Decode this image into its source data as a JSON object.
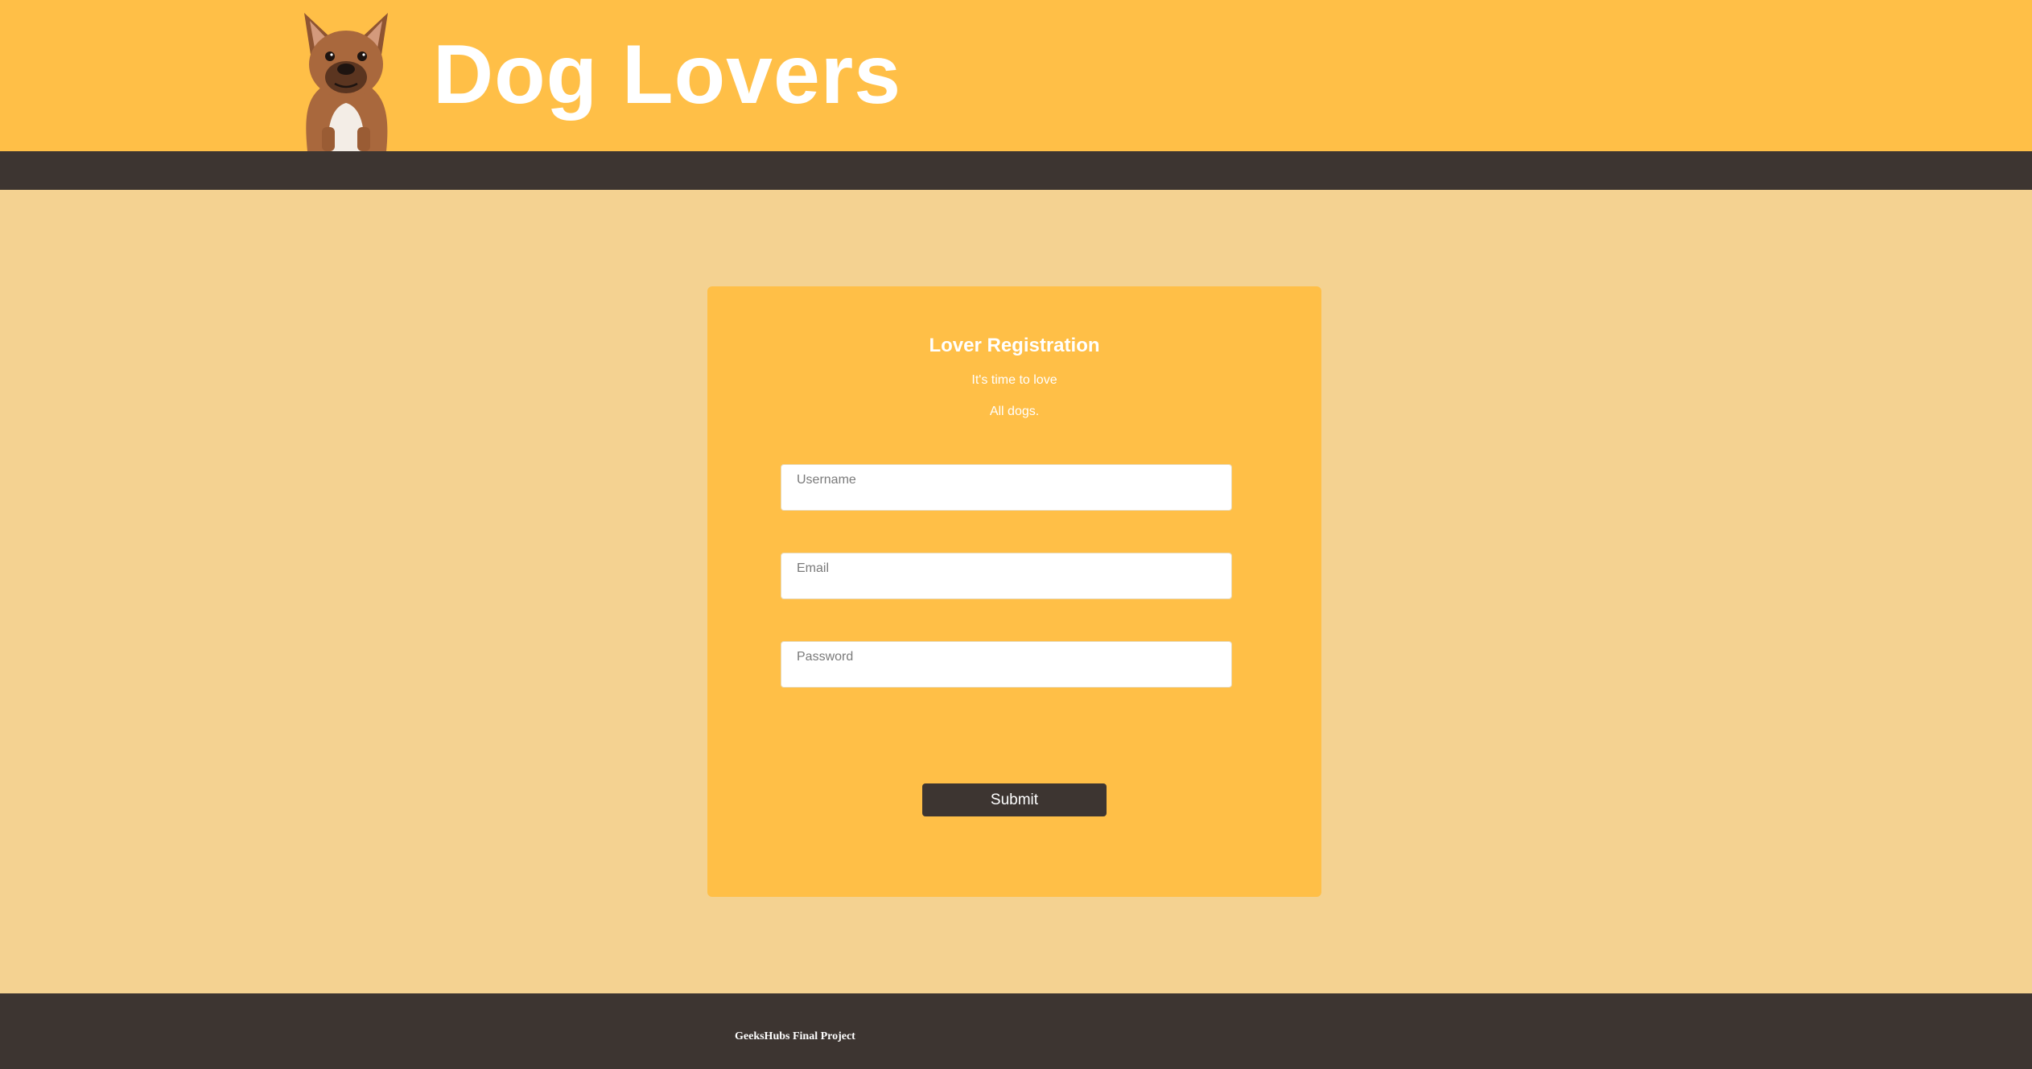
{
  "header": {
    "logo_icon": "french-bulldog-icon",
    "title": "Dog Lovers"
  },
  "form": {
    "title": "Lover Registration",
    "subtitle_line1": "It's time to love",
    "subtitle_line2": "All dogs.",
    "username": {
      "placeholder": "Username",
      "value": ""
    },
    "email": {
      "placeholder": "Email",
      "value": ""
    },
    "password": {
      "placeholder": "Password",
      "value": ""
    },
    "submit_label": "Submit"
  },
  "footer": {
    "text": "GeeksHubs Final Project"
  },
  "colors": {
    "header_bg": "#ffbf47",
    "nav_bg": "#3d3531",
    "page_bg": "#f4d291",
    "card_bg": "#ffbf47",
    "button_bg": "#3d3531",
    "text_light": "#ffffff"
  }
}
